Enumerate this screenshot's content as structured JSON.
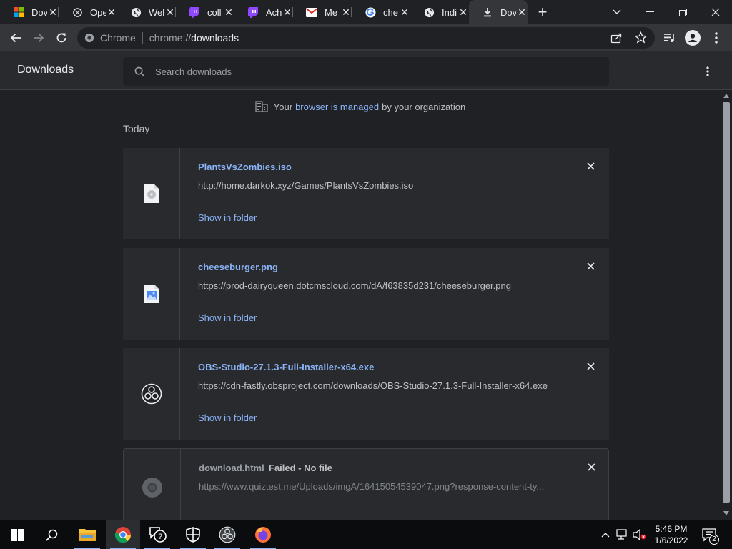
{
  "tabs": [
    {
      "title": "Dov",
      "icon": "microsoft-icon"
    },
    {
      "title": "Ope",
      "icon": "openai-icon"
    },
    {
      "title": "Wel",
      "icon": "globe-icon"
    },
    {
      "title": "coll",
      "icon": "twitch-icon"
    },
    {
      "title": "Ach",
      "icon": "twitch-icon"
    },
    {
      "title": "Me",
      "icon": "gmail-icon"
    },
    {
      "title": "che",
      "icon": "google-icon"
    },
    {
      "title": "Indi",
      "icon": "globe-icon"
    },
    {
      "title": "Dov",
      "icon": "download-icon",
      "active": true
    }
  ],
  "toolbar": {
    "site_chip": "Chrome",
    "url_scheme": "chrome://",
    "url_host": "downloads"
  },
  "page": {
    "title": "Downloads",
    "search_placeholder": "Search downloads"
  },
  "managed": {
    "prefix": "Your",
    "link": "browser is managed",
    "suffix": "by your organization"
  },
  "date_header": "Today",
  "downloads": [
    {
      "name": "PlantsVsZombies.iso",
      "url": "http://home.darkok.xyz/Games/PlantsVsZombies.iso",
      "action": "Show in folder",
      "icon": "disc-file-icon"
    },
    {
      "name": "cheeseburger.png",
      "url": "https://prod-dairyqueen.dotcmscloud.com/dA/f63835d231/cheeseburger.png",
      "action": "Show in folder",
      "icon": "image-file-icon"
    },
    {
      "name": "OBS-Studio-27.1.3-Full-Installer-x64.exe",
      "url": "https://cdn-fastly.obsproject.com/downloads/OBS-Studio-27.1.3-Full-Installer-x64.exe",
      "action": "Show in folder",
      "icon": "obs-icon"
    },
    {
      "name": "download.html",
      "status": "Failed - No file",
      "url": "https://www.quiztest.me/Uploads/imgA/16415054539047.png?response-content-ty...",
      "icon": "chrome-gray-icon"
    }
  ],
  "clock": {
    "time": "5:46 PM",
    "date": "1/6/2022"
  },
  "notifications_count": "2",
  "colors": {
    "link": "#8ab4f8",
    "background": "#202124",
    "card": "#292a2d"
  }
}
